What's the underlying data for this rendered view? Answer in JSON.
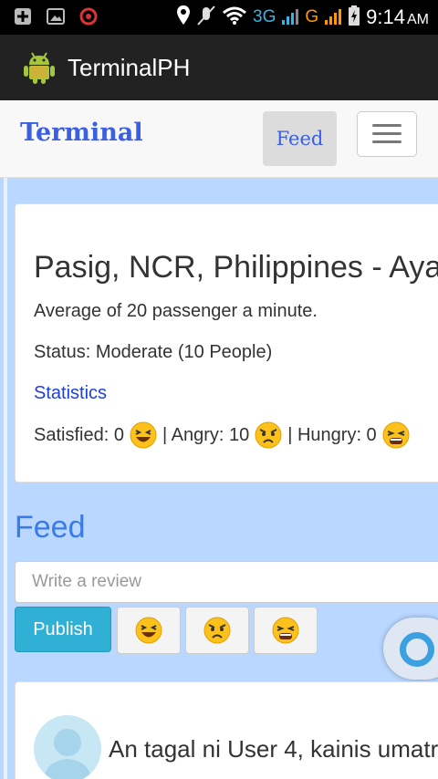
{
  "status_bar": {
    "left_icons": [
      "add-icon",
      "image-icon",
      "record-icon"
    ],
    "network_3g": "3G",
    "network_g": "G",
    "time": "9:14",
    "ampm": "AM"
  },
  "app_bar": {
    "title": "TerminalPH",
    "icon": "android-icon"
  },
  "navbar": {
    "brand": "Terminal",
    "feed_label": "Feed",
    "menu_icon": "hamburger-icon"
  },
  "terminal": {
    "location": "Pasig, NCR, Philippines - Aya",
    "average": "Average of 20 passenger a minute.",
    "status": "Status: Moderate (10 People)",
    "statistics_link": "Statistics",
    "satisfied_label": "Satisfied: 0",
    "angry_label": "| Angry: 10",
    "hungry_label": "| Hungry: 0"
  },
  "feed": {
    "heading": "Feed",
    "review_placeholder": "Write a review",
    "publish_label": "Publish",
    "reaction_buttons": [
      "laughing-emoji",
      "angry-emoji",
      "tired-emoji"
    ]
  },
  "posts": [
    {
      "text": "An tagal ni User 4, kainis umatr"
    }
  ],
  "colors": {
    "brand": "#3a5fe0",
    "feed_heading": "#3a7be8",
    "publish": "#31b0d5",
    "background": "#b9d7ff"
  }
}
